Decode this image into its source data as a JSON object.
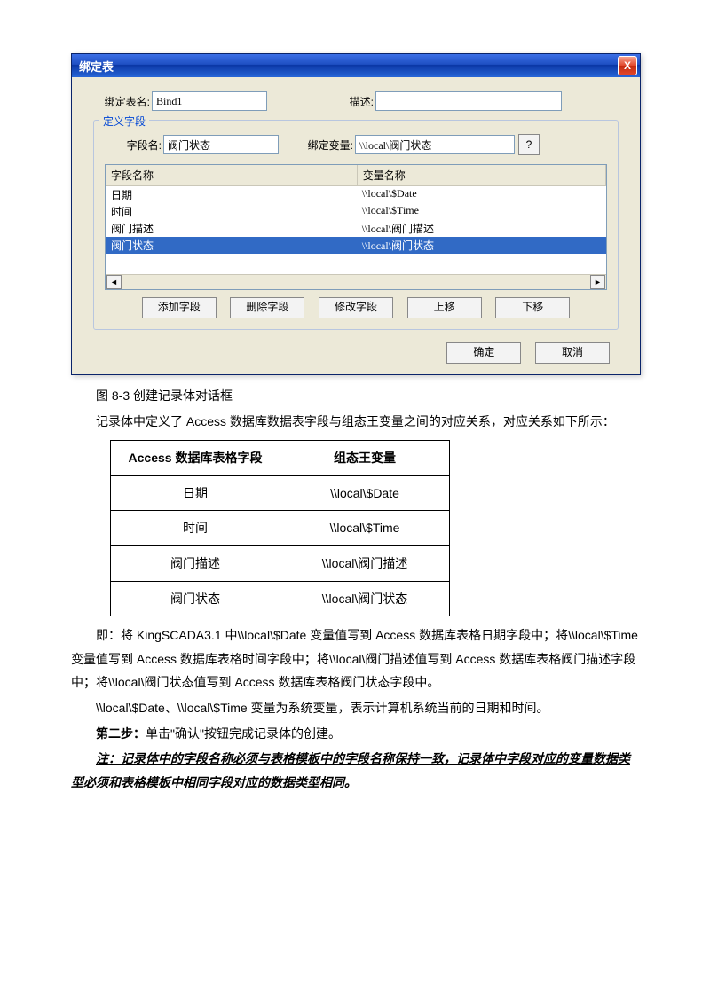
{
  "dialog": {
    "title": "绑定表",
    "close": "X",
    "bind_name_label": "绑定表名:",
    "bind_name_value": "Bind1",
    "desc_label": "描述:",
    "desc_value": "",
    "fieldset_legend": "定义字段",
    "field_name_label": "字段名:",
    "field_name_value": "阀门状态",
    "bind_var_label": "绑定变量:",
    "bind_var_value": "\\\\local\\阀门状态",
    "help_btn": "?",
    "list": {
      "header_field": "字段名称",
      "header_var": "变量名称",
      "rows": [
        {
          "field": "日期",
          "var": "\\\\local\\$Date",
          "sel": false
        },
        {
          "field": "时间",
          "var": "\\\\local\\$Time",
          "sel": false
        },
        {
          "field": "阀门描述",
          "var": "\\\\local\\阀门描述",
          "sel": false
        },
        {
          "field": "阀门状态",
          "var": "\\\\local\\阀门状态",
          "sel": true
        }
      ]
    },
    "btn_add": "添加字段",
    "btn_del": "删除字段",
    "btn_mod": "修改字段",
    "btn_up": "上移",
    "btn_down": "下移",
    "btn_ok": "确定",
    "btn_cancel": "取消"
  },
  "doc": {
    "caption": "图 8-3 创建记录体对话框",
    "intro": "记录体中定义了 Access 数据库数据表字段与组态王变量之间的对应关系，对应关系如下所示：",
    "table": {
      "h1": "Access 数据库表格字段",
      "h2": "组态王变量",
      "rows": [
        {
          "a": "日期",
          "b": "\\\\local\\$Date"
        },
        {
          "a": "时间",
          "b": "\\\\local\\$Time"
        },
        {
          "a": "阀门描述",
          "b": "\\\\local\\阀门描述"
        },
        {
          "a": "阀门状态",
          "b": "\\\\local\\阀门状态"
        }
      ]
    },
    "p1": "即：将 KingSCADA3.1 中\\\\local\\$Date 变量值写到 Access 数据库表格日期字段中；将\\\\local\\$Time 变量值写到 Access 数据库表格时间字段中；将\\\\local\\阀门描述值写到 Access 数据库表格阀门描述字段中；将\\\\local\\阀门状态值写到 Access 数据库表格阀门状态字段中。",
    "p2": "\\\\local\\$Date、\\\\local\\$Time 变量为系统变量，表示计算机系统当前的日期和时间。",
    "step2_label": "第二步：",
    "step2_text": "单击\"确认\"按钮完成记录体的创建。",
    "note_label": "注：",
    "note_text": "记录体中的字段名称必须与表格模板中的字段名称保持一致，记录体中字段对应的变量数据类型必须和表格模板中相同字段对应的数据类型相同。"
  }
}
